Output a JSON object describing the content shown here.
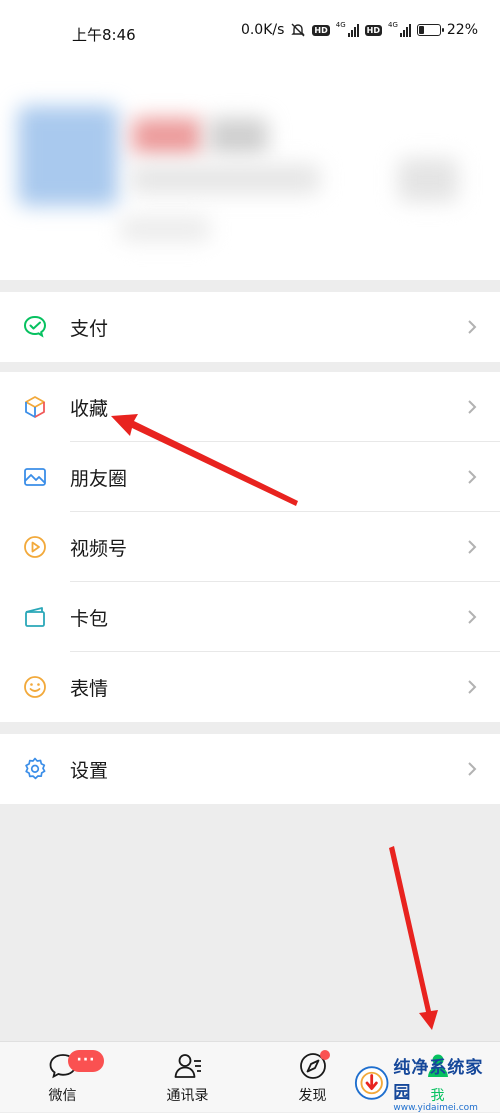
{
  "status_bar": {
    "time": "上午8:46",
    "net_speed": "0.0K/s",
    "hd1": "HD",
    "hd2": "HD",
    "net1": "4G",
    "net2": "4G",
    "battery": "22%"
  },
  "menu": {
    "pay": {
      "label": "支付",
      "icon": "wechat-pay-icon"
    },
    "favorites": {
      "label": "收藏",
      "icon": "cube-icon"
    },
    "moments": {
      "label": "朋友圈",
      "icon": "image-icon"
    },
    "channels": {
      "label": "视频号",
      "icon": "play-circle-icon"
    },
    "cards": {
      "label": "卡包",
      "icon": "card-icon"
    },
    "stickers": {
      "label": "表情",
      "icon": "smiley-icon"
    },
    "settings": {
      "label": "设置",
      "icon": "gear-icon"
    }
  },
  "tabbar": {
    "chats": {
      "label": "微信",
      "badge": "···"
    },
    "contacts": {
      "label": "通讯录"
    },
    "discover": {
      "label": "发现"
    },
    "me": {
      "label": "我"
    }
  },
  "watermark": {
    "title": "纯净系统家园",
    "url": "www.yidaimei.com"
  },
  "colors": {
    "brand_green": "#07c160",
    "badge_red": "#fa5151",
    "arrow_red": "#e8231f"
  }
}
